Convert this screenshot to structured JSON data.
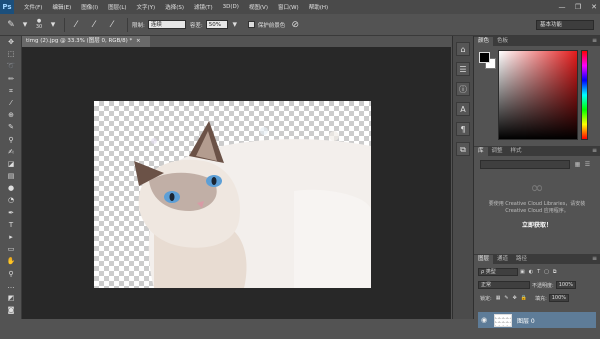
{
  "app": {
    "logo": "Ps"
  },
  "menu": {
    "items": [
      "文件(F)",
      "编辑(E)",
      "图像(I)",
      "图层(L)",
      "文字(Y)",
      "选择(S)",
      "滤镜(T)",
      "3D(D)",
      "视图(V)",
      "窗口(W)",
      "帮助(H)"
    ]
  },
  "window_controls": {
    "minimize": "—",
    "restore": "❐",
    "close": "✕"
  },
  "options": {
    "brush_size": "30",
    "limits_label": "限制:",
    "limits_value": "连续",
    "tolerance_label": "容差:",
    "tolerance_value": "50%",
    "protect_label": "保护前景色",
    "workspace": "基本功能"
  },
  "document": {
    "tab_title": "timg (2).jpg @ 33.3% (图层 0, RGB/8) *",
    "close": "×"
  },
  "color_panel": {
    "tabs": [
      "颜色",
      "色板"
    ],
    "fg_color": "#000000",
    "bg_color": "#ffffff",
    "accent": "#e31c1c"
  },
  "libraries_panel": {
    "tabs": [
      "库",
      "调整",
      "样式"
    ],
    "message": "要使用 Creative Cloud Libraries，请安装 Creative Cloud 应用程序。",
    "link": "立即获取！"
  },
  "layers_panel": {
    "tabs": [
      "图层",
      "通道",
      "路径"
    ],
    "filter_label": "ρ 类型",
    "blend_mode": "正常",
    "opacity_label": "不透明度:",
    "opacity_value": "100%",
    "lock_label": "锁定:",
    "fill_label": "填充:",
    "fill_value": "100%",
    "layer_name": "图层 0"
  },
  "tools": [
    "move-tool",
    "marquee-tool",
    "lasso-tool",
    "quick-select-tool",
    "crop-tool",
    "eyedropper-tool",
    "healing-brush-tool",
    "brush-tool",
    "clone-stamp-tool",
    "history-brush-tool",
    "eraser-tool",
    "gradient-tool",
    "blur-tool",
    "dodge-tool",
    "pen-tool",
    "type-tool",
    "path-select-tool",
    "shape-tool",
    "hand-tool",
    "zoom-tool"
  ]
}
